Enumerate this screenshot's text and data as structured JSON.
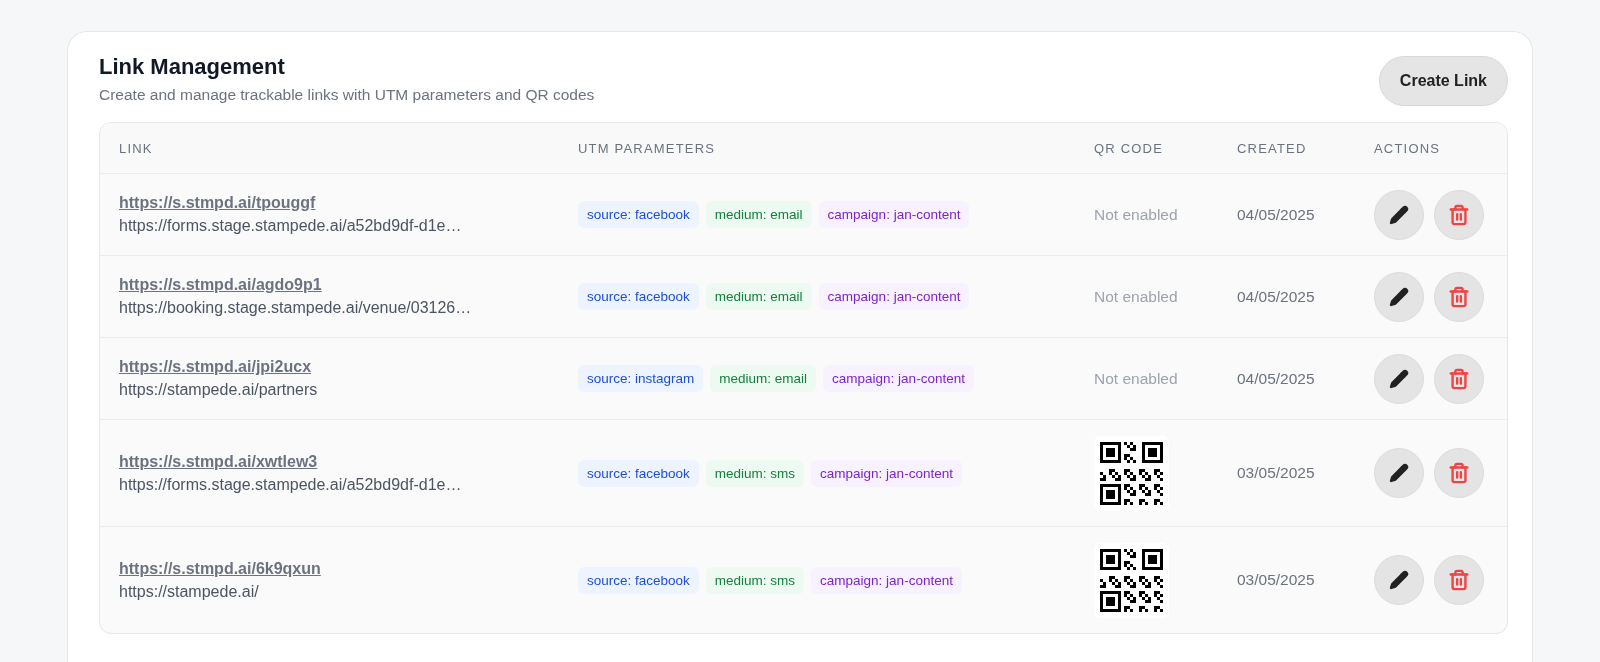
{
  "header": {
    "title": "Link Management",
    "subtitle": "Create and manage trackable links with UTM parameters and QR codes",
    "button": "Create Link"
  },
  "table": {
    "columns": [
      "LINK",
      "UTM PARAMETERS",
      "QR CODE",
      "CREATED",
      "ACTIONS"
    ],
    "rows": [
      {
        "short": "https://s.stmpd.ai/tpouggf",
        "target": "https://forms.stage.stampede.ai/a52bd9df-d1e…",
        "tags": [
          {
            "kind": "source",
            "text": "source: facebook"
          },
          {
            "kind": "medium",
            "text": "medium: email"
          },
          {
            "kind": "campaign",
            "text": "campaign: jan-content"
          }
        ],
        "qr": {
          "kind": "none",
          "text": "Not enabled"
        },
        "created": "04/05/2025"
      },
      {
        "short": "https://s.stmpd.ai/agdo9p1",
        "target": "https://booking.stage.stampede.ai/venue/03126…",
        "tags": [
          {
            "kind": "source",
            "text": "source: facebook"
          },
          {
            "kind": "medium",
            "text": "medium: email"
          },
          {
            "kind": "campaign",
            "text": "campaign: jan-content"
          }
        ],
        "qr": {
          "kind": "none",
          "text": "Not enabled"
        },
        "created": "04/05/2025"
      },
      {
        "short": "https://s.stmpd.ai/jpi2ucx",
        "target": "https://stampede.ai/partners",
        "tags": [
          {
            "kind": "source",
            "text": "source: instagram"
          },
          {
            "kind": "medium",
            "text": "medium: email"
          },
          {
            "kind": "campaign",
            "text": "campaign: jan-content"
          }
        ],
        "qr": {
          "kind": "none",
          "text": "Not enabled"
        },
        "created": "04/05/2025"
      },
      {
        "short": "https://s.stmpd.ai/xwtlew3",
        "target": "https://forms.stage.stampede.ai/a52bd9df-d1e…",
        "tags": [
          {
            "kind": "source",
            "text": "source: facebook"
          },
          {
            "kind": "medium",
            "text": "medium: sms"
          },
          {
            "kind": "campaign",
            "text": "campaign: jan-content"
          }
        ],
        "qr": {
          "kind": "code"
        },
        "created": "03/05/2025"
      },
      {
        "short": "https://s.stmpd.ai/6k9qxun",
        "target": "https://stampede.ai/",
        "tags": [
          {
            "kind": "source",
            "text": "source: facebook"
          },
          {
            "kind": "medium",
            "text": "medium: sms"
          },
          {
            "kind": "campaign",
            "text": "campaign: jan-content"
          }
        ],
        "qr": {
          "kind": "code"
        },
        "created": "03/05/2025"
      }
    ]
  }
}
